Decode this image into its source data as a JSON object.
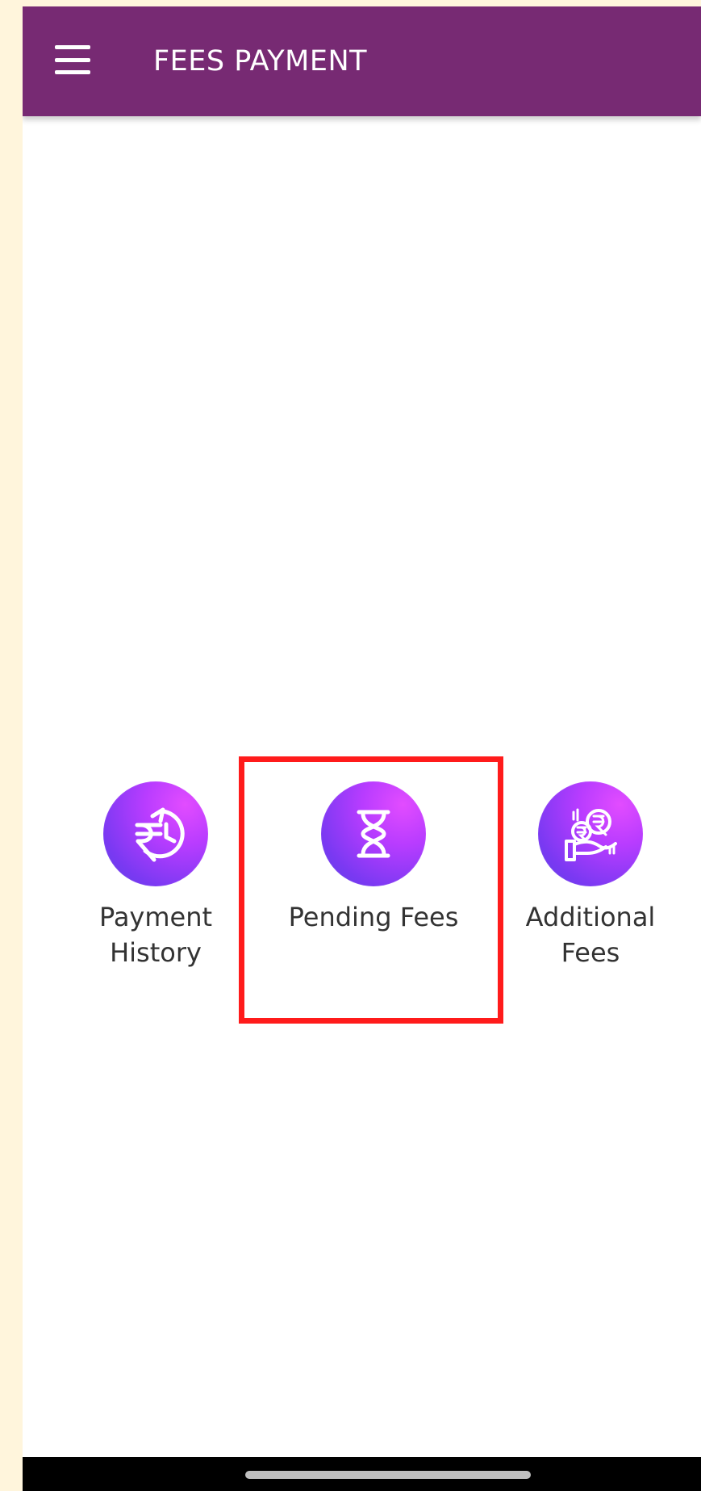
{
  "header": {
    "title": "FEES PAYMENT",
    "menu_icon": "hamburger-menu-icon"
  },
  "actions": [
    {
      "label": "Payment\nHistory",
      "icon": "rupee-history-icon"
    },
    {
      "label": "Pending Fees",
      "icon": "hourglass-icon",
      "highlighted": true
    },
    {
      "label": "Additional\nFees",
      "icon": "hand-coins-icon"
    }
  ],
  "theme": {
    "appbar_color": "#772a73",
    "highlight_border_color": "#ff1b1b",
    "icon_gradient_start": "#e24cff",
    "icon_gradient_end": "#5d3ee6",
    "background_color": "#fff5dc"
  }
}
